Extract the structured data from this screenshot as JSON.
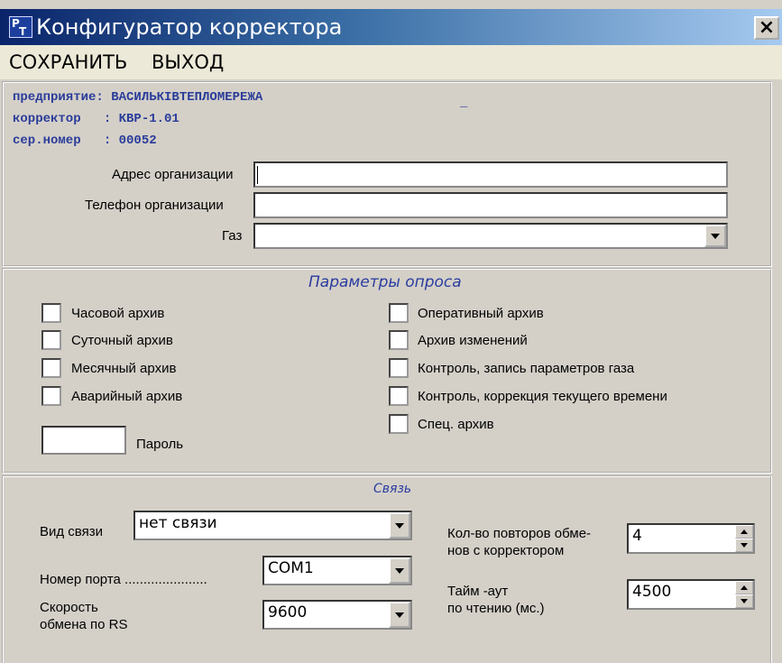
{
  "window": {
    "title": "Конфигуратор корректора",
    "icon": "app-icon",
    "close_symbol": "×"
  },
  "menu": {
    "save": "СОХРАНИТЬ",
    "exit": "ВЫХОД"
  },
  "info": {
    "enterprise": "предприятие: ВАСИЛЬКIВТЕПЛОМЕРЕЖА",
    "corrector": "корректор   : КВР-1.01",
    "serial": "сер.номер   : 00052",
    "dash": "_"
  },
  "org": {
    "address_label": "Адрес организации",
    "address_value": "",
    "phone_label": "Телефон организации",
    "phone_value": "",
    "gas_label": "Газ",
    "gas_value": ""
  },
  "poll": {
    "title": "Параметры опроса",
    "left": [
      "Часовой архив",
      "Суточный архив",
      "Месячный архив",
      "Аварийный архив"
    ],
    "right": [
      "Оперативный архив",
      "Архив изменений",
      "Контроль, запись параметров газа",
      "Контроль, коррекция текущего времени",
      "Спец. архив"
    ],
    "password_label": "Пароль",
    "password_value": ""
  },
  "link": {
    "title": "Связь",
    "type_label": "Вид связи",
    "type_value": "нет связи",
    "port_label": "Номер порта ......................",
    "port_value": "COM1",
    "speed_label_1": "Скорость",
    "speed_label_2": "обмена по RS",
    "speed_value": "9600",
    "retries_label_1": "Кол-во повторов обме-",
    "retries_label_2": "нов с корректором",
    "retries_value": "4",
    "timeout_label_1": "Тайм -аут",
    "timeout_label_2": "по чтению (мс.)",
    "timeout_value": "4500"
  },
  "colors": {
    "title_start": "#0a246a",
    "title_end": "#a6caf0",
    "accent_text": "#2a3ca0",
    "face": "#d4d0c8"
  }
}
